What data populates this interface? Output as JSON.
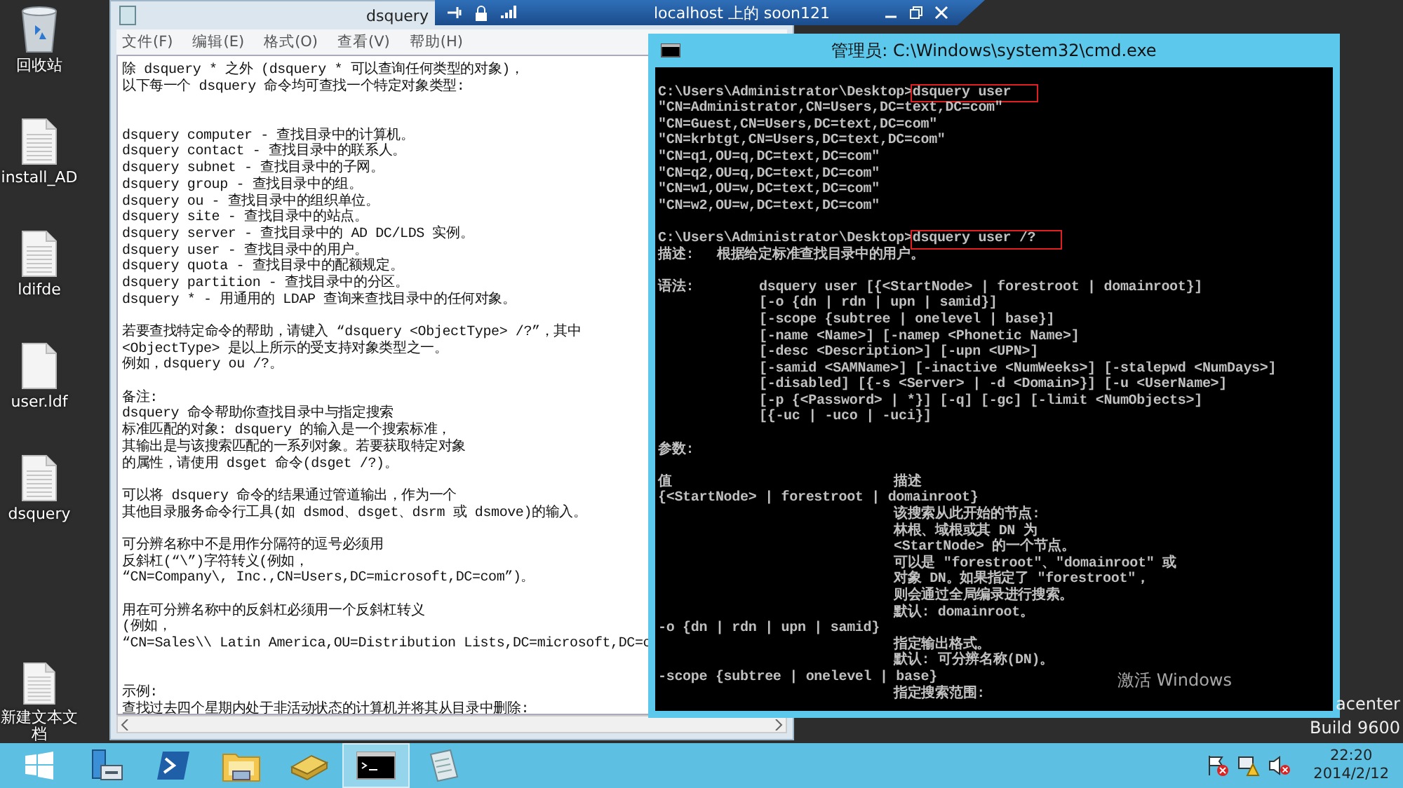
{
  "desktop": {
    "icons": [
      {
        "label": "回收站",
        "kind": "recycle"
      },
      {
        "label": "install_AD",
        "kind": "lined"
      },
      {
        "label": "ldifde",
        "kind": "lined"
      },
      {
        "label": "user.ldf",
        "kind": "blank"
      },
      {
        "label": "dsquery",
        "kind": "lined"
      },
      {
        "label": "新建文本文档",
        "kind": "lined"
      }
    ],
    "notice": [
      "激活 Windows",
      "acenter",
      "Build 9600"
    ]
  },
  "remote_bar": {
    "title": "localhost 上的 soon121"
  },
  "notepad": {
    "title": "dsquery",
    "menu": [
      "文件(F)",
      "编辑(E)",
      "格式(O)",
      "查看(V)",
      "帮助(H)"
    ],
    "lines": [
      {
        "kind": "text",
        "text": "除 dsquery * 之外 (dsquery * 可以查询任何类型的对象)，"
      },
      {
        "kind": "text",
        "text": "以下每一个 dsquery 命令均可查找一个特定对象类型:"
      },
      {
        "kind": "blank"
      },
      {
        "kind": "blank"
      },
      {
        "kind": "text",
        "text": "dsquery computer - 查找目录中的计算机。"
      },
      {
        "kind": "text",
        "text": "dsquery contact - 查找目录中的联系人。"
      },
      {
        "kind": "text",
        "text": "dsquery subnet - 查找目录中的子网。"
      },
      {
        "kind": "text",
        "text": "dsquery group - 查找目录中的组。"
      },
      {
        "kind": "text",
        "text": "dsquery ou - 查找目录中的组织单位。"
      },
      {
        "kind": "text",
        "text": "dsquery site - 查找目录中的站点。"
      },
      {
        "kind": "text",
        "text": "dsquery server - 查找目录中的 AD DC/LDS 实例。"
      },
      {
        "kind": "text",
        "text": "dsquery user - 查找目录中的用户。"
      },
      {
        "kind": "text",
        "text": "dsquery quota - 查找目录中的配额规定。"
      },
      {
        "kind": "text",
        "text": "dsquery partition - 查找目录中的分区。"
      },
      {
        "kind": "text",
        "text": "dsquery * - 用通用的 LDAP 查询来查找目录中的任何对象。"
      },
      {
        "kind": "blank"
      },
      {
        "kind": "text",
        "text": "若要查找特定命令的帮助，请键入 “dsquery <ObjectType> /?”，其中"
      },
      {
        "kind": "text",
        "text": "<ObjectType> 是以上所示的受支持对象类型之一。"
      },
      {
        "kind": "text",
        "text": "例如，dsquery ou /?。"
      },
      {
        "kind": "blank"
      },
      {
        "kind": "text",
        "text": "备注:"
      },
      {
        "kind": "text",
        "text": "dsquery 命令帮助你查找目录中与指定搜索"
      },
      {
        "kind": "text",
        "text": "标准匹配的对象: dsquery 的输入是一个搜索标准，"
      },
      {
        "kind": "text",
        "text": "其输出是与该搜索匹配的一系列对象。若要获取特定对象"
      },
      {
        "kind": "text",
        "text": "的属性，请使用 dsget 命令(dsget /?)。"
      },
      {
        "kind": "blank"
      },
      {
        "kind": "text",
        "text": "可以将 dsquery 命令的结果通过管道输出，作为一个"
      },
      {
        "kind": "text",
        "text": "其他目录服务命令行工具(如 dsmod、dsget、dsrm 或 dsmove)的输入。"
      },
      {
        "kind": "blank"
      },
      {
        "kind": "text",
        "text": "可分辨名称中不是用作分隔符的逗号必须用"
      },
      {
        "kind": "text",
        "text": "反斜杠(“\\”)字符转义(例如，"
      },
      {
        "kind": "text",
        "text": "“CN=Company\\, Inc.,CN=Users,DC=microsoft,DC=com”)。"
      },
      {
        "kind": "blank"
      },
      {
        "kind": "text",
        "text": "用在可分辨名称中的反斜杠必须用一个反斜杠转义"
      },
      {
        "kind": "text",
        "text": "(例如，"
      },
      {
        "kind": "text",
        "text": "“CN=Sales\\\\ Latin America,OU=Distribution Lists,DC=microsoft,DC=c"
      },
      {
        "kind": "blank"
      },
      {
        "kind": "blank"
      },
      {
        "kind": "text",
        "text": "示例:"
      },
      {
        "kind": "text",
        "text": "查找过去四个星期内处于非活动状态的计算机并将其从目录中删除:"
      }
    ]
  },
  "cmd": {
    "title": "管理员: C:\\Windows\\system32\\cmd.exe",
    "lines": [
      {
        "kind": "blank"
      },
      {
        "kind": "prompt",
        "prompt": "C:\\Users\\Administrator\\Desktop>",
        "command": "dsquery user",
        "highlighted": true
      },
      {
        "kind": "plain",
        "text": "\"CN=Administrator,CN=Users,DC=text,DC=com\""
      },
      {
        "kind": "plain",
        "text": "\"CN=Guest,CN=Users,DC=text,DC=com\""
      },
      {
        "kind": "plain",
        "text": "\"CN=krbtgt,CN=Users,DC=text,DC=com\""
      },
      {
        "kind": "plain",
        "text": "\"CN=q1,OU=q,DC=text,DC=com\""
      },
      {
        "kind": "plain",
        "text": "\"CN=q2,OU=q,DC=text,DC=com\""
      },
      {
        "kind": "plain",
        "text": "\"CN=w1,OU=w,DC=text,DC=com\""
      },
      {
        "kind": "plain",
        "text": "\"CN=w2,OU=w,DC=text,DC=com\""
      },
      {
        "kind": "blank"
      },
      {
        "kind": "prompt",
        "prompt": "C:\\Users\\Administrator\\Desktop>",
        "command": "dsquery user /?",
        "highlighted": true
      },
      {
        "kind": "labeled",
        "label": "描述:",
        "text": "根据给定标准查找目录中的用户。"
      },
      {
        "kind": "blank"
      },
      {
        "kind": "syntax",
        "label": "语法:",
        "text": "dsquery user [{<StartNode> | forestroot | domainroot}]"
      },
      {
        "kind": "syntax",
        "text": "[-o {dn | rdn | upn | samid}]"
      },
      {
        "kind": "syntax",
        "text": "[-scope {subtree | onelevel | base}]"
      },
      {
        "kind": "syntax",
        "text": "[-name <Name>] [-namep <Phonetic Name>]"
      },
      {
        "kind": "syntax",
        "text": "[-desc <Description>] [-upn <UPN>]"
      },
      {
        "kind": "syntax",
        "text": "[-samid <SAMName>] [-inactive <NumWeeks>] [-stalepwd <NumDays>]"
      },
      {
        "kind": "syntax",
        "text": "[-disabled] [{-s <Server> | -d <Domain>}] [-u <UserName>]"
      },
      {
        "kind": "syntax",
        "text": "[-p {<Password> | *}] [-q] [-gc] [-limit <NumObjects>]"
      },
      {
        "kind": "syntax",
        "text": "[{-uc | -uco | -uci}]"
      },
      {
        "kind": "blank"
      },
      {
        "kind": "plain",
        "text": "参数:"
      },
      {
        "kind": "blank"
      },
      {
        "kind": "header",
        "label": "值",
        "text": "描述"
      },
      {
        "kind": "plain",
        "text": "{<StartNode> | forestroot | domainroot}"
      },
      {
        "kind": "desc",
        "text": "该搜索从此开始的节点:"
      },
      {
        "kind": "desc",
        "text": "林根、域根或其 DN 为"
      },
      {
        "kind": "desc",
        "text": "<StartNode> 的一个节点。"
      },
      {
        "kind": "desc",
        "text": "可以是 \"forestroot\"、\"domainroot\" 或"
      },
      {
        "kind": "desc",
        "text": "对象 DN。如果指定了 \"forestroot\"，"
      },
      {
        "kind": "desc",
        "text": "则会通过全局编录进行搜索。"
      },
      {
        "kind": "desc",
        "text": "默认: domainroot。"
      },
      {
        "kind": "plain",
        "text": "-o {dn | rdn | upn | samid}"
      },
      {
        "kind": "desc",
        "text": "指定输出格式。"
      },
      {
        "kind": "desc",
        "text": "默认: 可分辨名称(DN)。"
      },
      {
        "kind": "plain",
        "text": "-scope {subtree | onelevel | base}"
      },
      {
        "kind": "desc",
        "text": "指定搜索范围:"
      }
    ]
  },
  "taskbar": {
    "items": [
      {
        "kind": "start",
        "selected": false
      },
      {
        "kind": "server",
        "selected": false
      },
      {
        "kind": "powershell",
        "selected": false
      },
      {
        "kind": "explorer",
        "selected": false
      },
      {
        "kind": "books",
        "selected": false
      },
      {
        "kind": "cmd",
        "selected": true
      },
      {
        "kind": "notepad",
        "selected": false
      }
    ],
    "time": "22:20",
    "date": "2014/2/12"
  }
}
